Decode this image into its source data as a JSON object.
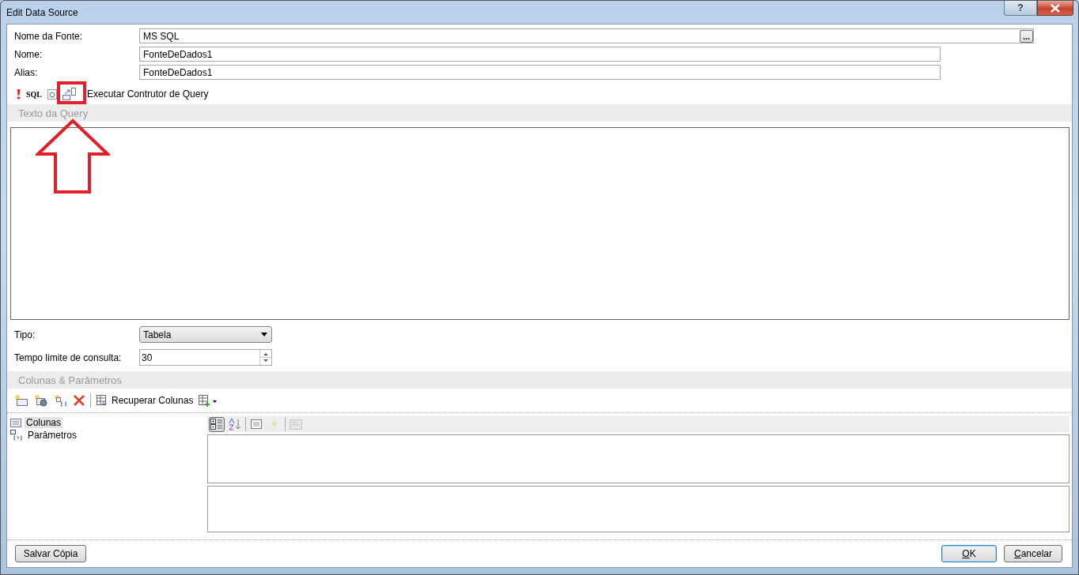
{
  "window": {
    "title": "Edit Data Source",
    "help": "?"
  },
  "fields": [
    {
      "label": "Nome da Fonte:",
      "value": "MS SQL",
      "kind": "browse",
      "button": "..."
    },
    {
      "label": "Nome:",
      "value": "FonteDeDados1",
      "kind": "text"
    },
    {
      "label": "Alias:",
      "value": "FonteDeDados1",
      "kind": "text"
    }
  ],
  "query_toolbar": {
    "sql": "SQL",
    "action": "Executar Contrutor de Query"
  },
  "query_section": {
    "title": "Texto da Query"
  },
  "options": [
    {
      "label": "Tipo:",
      "value": "Tabela",
      "kind": "dropdown"
    },
    {
      "label": "Tempo limite de consulta:",
      "value": "30",
      "kind": "spinner"
    }
  ],
  "columns_section": {
    "title": "Colunas & Parâmetros",
    "retrieve": "Recuperar Colunas",
    "tree": [
      {
        "label": "Colunas",
        "selected": true,
        "kind": "columns"
      },
      {
        "label": "Parâmetros",
        "selected": false,
        "kind": "parameters"
      }
    ],
    "props_toolbar": [
      {
        "kind": "categorized",
        "selected": true,
        "disabled": false
      },
      {
        "kind": "alphabetical",
        "selected": false,
        "disabled": false
      },
      {
        "kind": "properties",
        "selected": false,
        "disabled": false
      },
      {
        "kind": "events",
        "selected": false,
        "disabled": true
      },
      {
        "kind": "pages",
        "selected": false,
        "disabled": true
      }
    ]
  },
  "buttons": [
    {
      "label": "Salvar Cópia",
      "kind": "left"
    },
    {
      "label": "OK",
      "kind": "default"
    },
    {
      "label": "Cancelar",
      "kind": "normal"
    }
  ],
  "annotation": {
    "kind": "arrow"
  }
}
